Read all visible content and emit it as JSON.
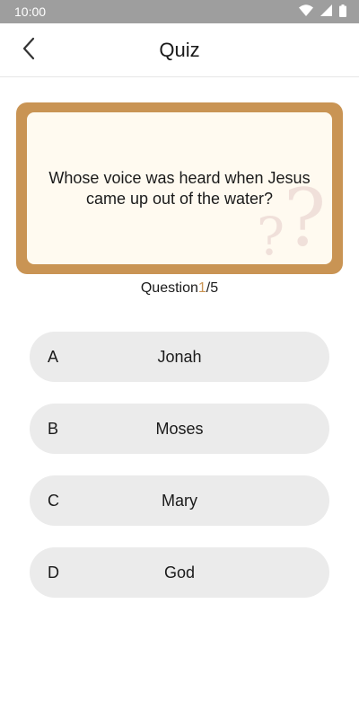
{
  "status_bar": {
    "time": "10:00",
    "icons": [
      "wifi-icon",
      "cell-signal-icon",
      "battery-icon"
    ]
  },
  "app_bar": {
    "title": "Quiz",
    "back_icon": "chevron-left-icon"
  },
  "question": {
    "text": "Whose voice was heard when Jesus came up out of the water?",
    "decoration_icon": "question-marks-icon"
  },
  "progress": {
    "prefix": "Question",
    "current": "1",
    "separator": "/",
    "total": "5"
  },
  "options": [
    {
      "letter": "A",
      "text": "Jonah"
    },
    {
      "letter": "B",
      "text": "Moses"
    },
    {
      "letter": "C",
      "text": "Mary"
    },
    {
      "letter": "D",
      "text": "God"
    }
  ],
  "colors": {
    "accent": "#c99454",
    "card_background": "#fffaf0",
    "option_background": "#ebebeb",
    "status_bar": "#9e9e9e"
  }
}
